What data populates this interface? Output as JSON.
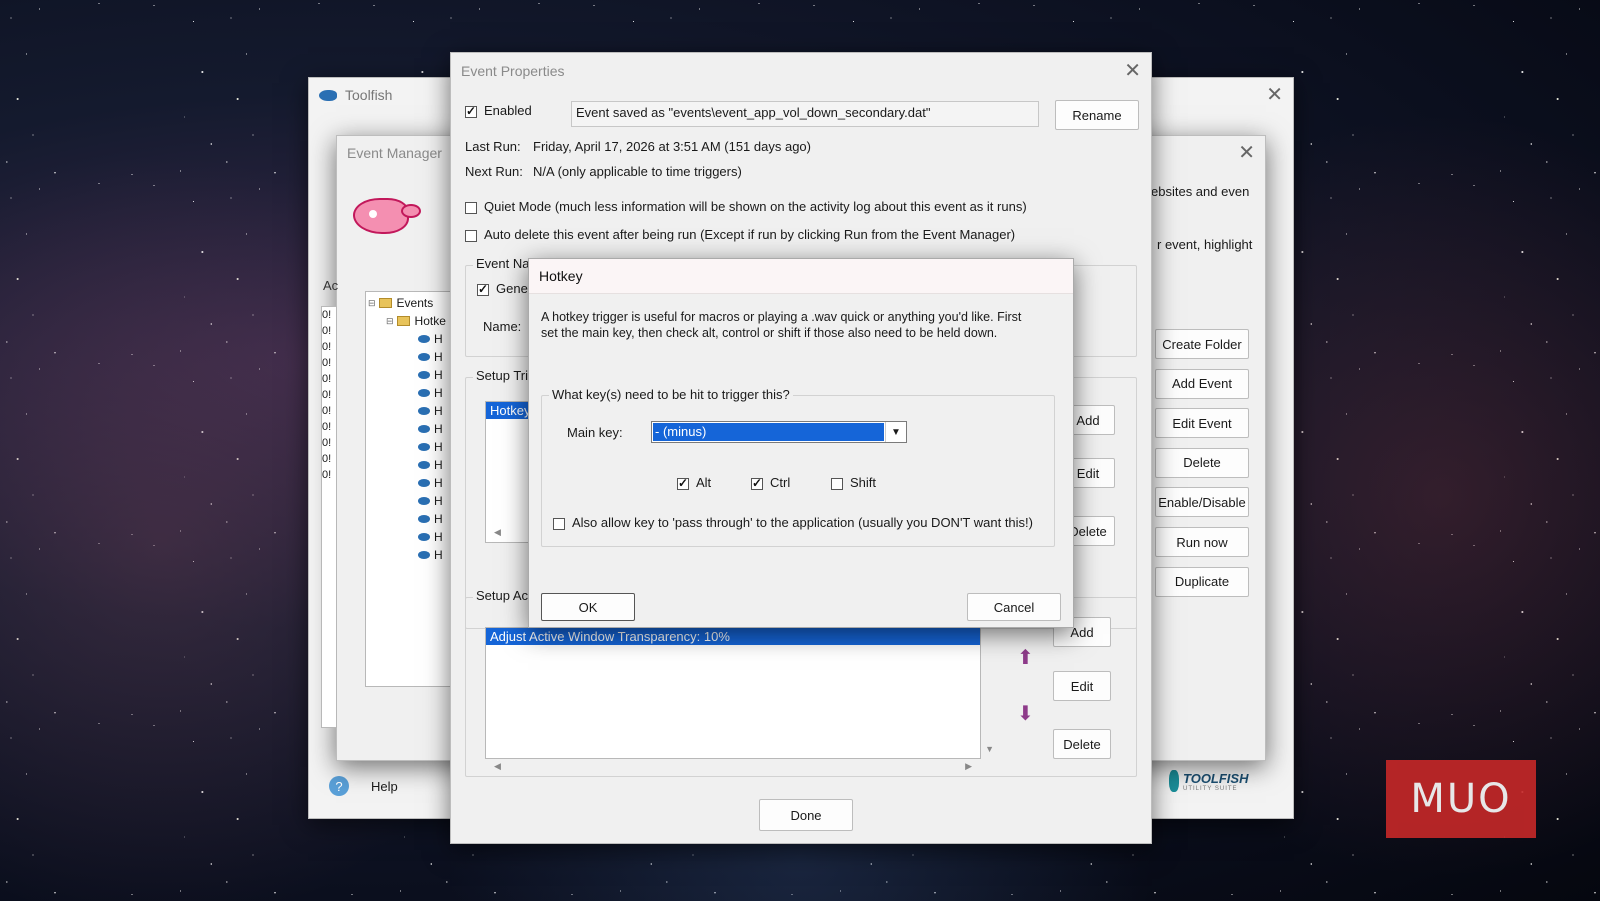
{
  "toolfish": {
    "title": "Toolfish",
    "help": "Help",
    "logo": "TOOLFISH",
    "logo_sub": "UTILITY SUITE"
  },
  "event_manager": {
    "title": "Event Manager",
    "right_text_1": "ebsites and even",
    "right_text_2": "r event, highlight",
    "left_label": "Ac",
    "log_rows": [
      "0!",
      "0!",
      "0!",
      "0!",
      "0!",
      "0!",
      "0!",
      "0!",
      "0!",
      "0!",
      "0!"
    ],
    "tree": {
      "root": "Events",
      "folder": "Hotke",
      "items": [
        "H",
        "H",
        "H",
        "H",
        "H",
        "H",
        "H",
        "H",
        "H",
        "H",
        "H",
        "H",
        "H"
      ]
    },
    "buttons": [
      "Create Folder",
      "Add Event",
      "Edit Event",
      "Delete",
      "Enable/Disable",
      "Run now",
      "Duplicate"
    ]
  },
  "event_props": {
    "title": "Event Properties",
    "enabled_label": "Enabled",
    "saved_text": "Event saved as \"events\\event_app_vol_down_secondary.dat\"",
    "rename": "Rename",
    "last_run_label": "Last Run:",
    "last_run_value": "Friday, April 17, 2026 at  3:51 AM (151 days ago)",
    "next_run_label": "Next Run:",
    "next_run_value": "N/A (only applicable to time triggers)",
    "quiet_mode": "Quiet Mode (much less information will be shown on the activity log about this event as it runs)",
    "auto_delete": "Auto delete this event after being run (Except if run by clicking Run from the Event Manager)",
    "event_name_group": "Event Na",
    "gene_label": "Gene",
    "name_label": "Name:",
    "setup_triggers": "Setup Tri",
    "trigger_item": "Hotkey",
    "trigger_buttons": [
      "Add",
      "Edit",
      "Delete"
    ],
    "setup_actions": "Setup Ac",
    "action_item": "Adjust Active Window Transparency: 10%",
    "action_buttons": [
      "Add",
      "Edit",
      "Delete"
    ],
    "done": "Done"
  },
  "hotkey": {
    "title": "Hotkey",
    "description": "A hotkey trigger is useful for macros or playing a .wav quick or anything you'd like.  First set the main key, then check alt, control or shift if those also need to be held down.",
    "question": "What key(s) need to be hit to trigger this?",
    "main_key_label": "Main key:",
    "main_key_value": "- (minus)",
    "alt": "Alt",
    "ctrl": "Ctrl",
    "shift": "Shift",
    "passthrough": "Also allow key to 'pass through' to the application (usually you DON'T want this!)",
    "ok": "OK",
    "cancel": "Cancel"
  },
  "watermark": "MUO"
}
